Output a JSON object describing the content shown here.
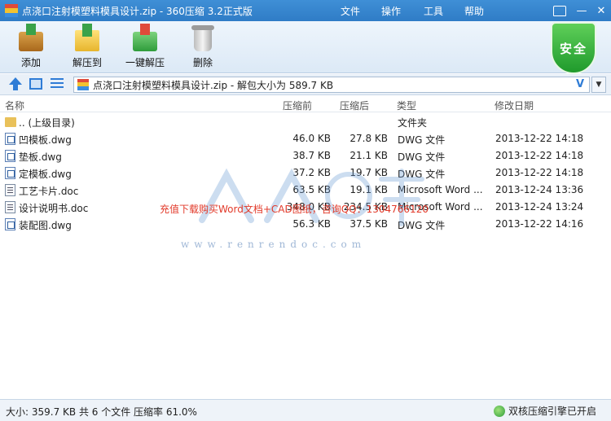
{
  "window": {
    "title": "点浇口注射模塑料模具设计.zip - 360压缩 3.2正式版",
    "menu": [
      "文件",
      "操作",
      "工具",
      "帮助"
    ],
    "minimize": "—",
    "close": "✕"
  },
  "toolbar": {
    "add": "添加",
    "extract": "解压到",
    "one_click": "一键解压",
    "delete": "删除",
    "shield": "安全"
  },
  "address": {
    "path": "点浇口注射模塑料模具设计.zip - 解包大小为 589.7 KB",
    "v_mark": "V",
    "dropdown": "▼"
  },
  "columns": {
    "name": "名称",
    "packed": "压缩前",
    "unpacked": "压缩后",
    "type": "类型",
    "modified": "修改日期"
  },
  "rows": [
    {
      "icon": "folder",
      "name": ".. (上级目录)",
      "packed": "",
      "unpacked": "",
      "type": "文件夹",
      "date": ""
    },
    {
      "icon": "dwg",
      "name": "凹模板.dwg",
      "packed": "46.0 KB",
      "unpacked": "27.8 KB",
      "type": "DWG 文件",
      "date": "2013-12-22 14:18"
    },
    {
      "icon": "dwg",
      "name": "垫板.dwg",
      "packed": "38.7 KB",
      "unpacked": "21.1 KB",
      "type": "DWG 文件",
      "date": "2013-12-22 14:18"
    },
    {
      "icon": "dwg",
      "name": "定模板.dwg",
      "packed": "37.2 KB",
      "unpacked": "19.7 KB",
      "type": "DWG 文件",
      "date": "2013-12-22 14:18"
    },
    {
      "icon": "doc",
      "name": "工艺卡片.doc",
      "packed": "63.5 KB",
      "unpacked": "19.1 KB",
      "type": "Microsoft Word ...",
      "date": "2013-12-24 13:36"
    },
    {
      "icon": "doc",
      "name": "设计说明书.doc",
      "packed": "348.0 KB",
      "unpacked": "234.5 KB",
      "type": "Microsoft Word ...",
      "date": "2013-12-24 13:24"
    },
    {
      "icon": "dwg",
      "name": "装配图.dwg",
      "packed": "56.3 KB",
      "unpacked": "37.5 KB",
      "type": "DWG 文件",
      "date": "2013-12-22 14:16"
    }
  ],
  "watermark": {
    "promo": "充值下载购买Word文档+CAD图纸，咨询QQ：1304766120",
    "url": "www.renrendoc.com"
  },
  "status": {
    "summary": "大小: 359.7 KB 共 6 个文件 压缩率 61.0%",
    "engine": "双核压缩引擎已开启"
  },
  "colors": {
    "titlebar": "#2f7cc6",
    "accent": "#2f7cd6",
    "shield": "#1f9a2c",
    "promo": "#e23a2a"
  }
}
